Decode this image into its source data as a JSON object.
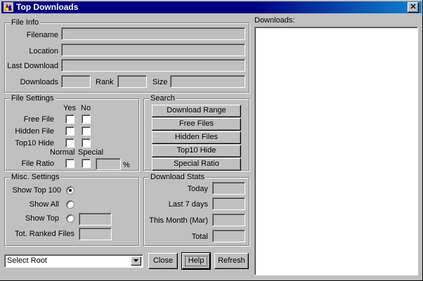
{
  "window": {
    "title": "Top Downloads",
    "close_glyph": "✕"
  },
  "file_info": {
    "legend": "File Info",
    "filename_label": "Filename",
    "location_label": "Location",
    "last_download_label": "Last Download",
    "downloads_label": "Downloads",
    "rank_label": "Rank",
    "size_label": "Size",
    "filename_value": "",
    "location_value": "",
    "last_download_value": "",
    "downloads_value": "",
    "rank_value": "",
    "size_value": ""
  },
  "file_settings": {
    "legend": "File Settings",
    "yes_label": "Yes",
    "no_label": "No",
    "free_file_label": "Free File",
    "hidden_file_label": "Hidden File",
    "top10_hide_label": "Top10 Hide",
    "normal_label": "Normal",
    "special_label": "Special",
    "file_ratio_label": "File Ratio",
    "percent_label": "%",
    "ratio_value": ""
  },
  "search": {
    "legend": "Search",
    "buttons": [
      "Download Range",
      "Free Files",
      "Hidden Files",
      "Top10 Hide",
      "Special Ratio"
    ]
  },
  "misc_settings": {
    "legend": "Misc. Settings",
    "show_top_100_label": "Show Top 100",
    "show_all_label": "Show All",
    "show_top_label": "Show Top",
    "tot_ranked_label": "Tot. Ranked Files",
    "show_top_value": "",
    "tot_ranked_value": "",
    "selected": "show_top_100"
  },
  "download_stats": {
    "legend": "Download Stats",
    "today_label": "Today",
    "last7_label": "Last 7 days",
    "this_month_label": "This Month (Mar)",
    "total_label": "Total",
    "today_value": "",
    "last7_value": "",
    "this_month_value": "",
    "total_value": ""
  },
  "bottom": {
    "select_value": "Select Root",
    "close_label": "Close",
    "help_label": "Help",
    "refresh_label": "Refresh"
  },
  "downloads_panel": {
    "label": "Downloads:",
    "items": []
  }
}
